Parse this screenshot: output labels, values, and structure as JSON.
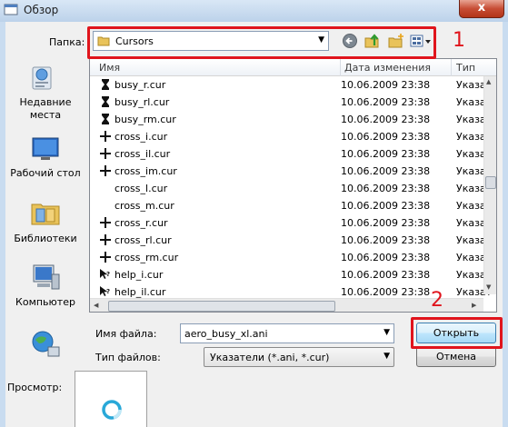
{
  "window": {
    "title": "Обзор",
    "close_glyph": "x"
  },
  "lookin": {
    "label": "Папка:",
    "value": "Cursors",
    "icon": "folder-icon"
  },
  "nav_tools": [
    "back-icon",
    "up-folder-icon",
    "new-folder-icon",
    "view-menu-icon"
  ],
  "places": [
    {
      "label_lines": [
        "Недавние",
        "места"
      ],
      "icon": "recent-places-icon"
    },
    {
      "label_lines": [
        "Рабочий стол"
      ],
      "icon": "desktop-icon"
    },
    {
      "label_lines": [
        "Библиотеки"
      ],
      "icon": "libraries-icon"
    },
    {
      "label_lines": [
        "Компьютер"
      ],
      "icon": "computer-icon"
    },
    {
      "label_lines": [],
      "icon": "network-icon"
    }
  ],
  "list": {
    "columns": [
      "Имя",
      "Дата изменения",
      "Тип"
    ],
    "rows": [
      {
        "name": "busy_r.cur",
        "date": "10.06.2009 23:38",
        "type": "Указат",
        "icon": "hourglass-icon"
      },
      {
        "name": "busy_rl.cur",
        "date": "10.06.2009 23:38",
        "type": "Указат",
        "icon": "hourglass-icon"
      },
      {
        "name": "busy_rm.cur",
        "date": "10.06.2009 23:38",
        "type": "Указат",
        "icon": "hourglass-icon"
      },
      {
        "name": "cross_i.cur",
        "date": "10.06.2009 23:38",
        "type": "Указат",
        "icon": "crosshair-icon"
      },
      {
        "name": "cross_il.cur",
        "date": "10.06.2009 23:38",
        "type": "Указат",
        "icon": "crosshair-icon"
      },
      {
        "name": "cross_im.cur",
        "date": "10.06.2009 23:38",
        "type": "Указат",
        "icon": "crosshair-icon"
      },
      {
        "name": "cross_l.cur",
        "date": "10.06.2009 23:38",
        "type": "Указат",
        "icon": "blank-icon"
      },
      {
        "name": "cross_m.cur",
        "date": "10.06.2009 23:38",
        "type": "Указат",
        "icon": "blank-icon"
      },
      {
        "name": "cross_r.cur",
        "date": "10.06.2009 23:38",
        "type": "Указат",
        "icon": "crosshair-icon"
      },
      {
        "name": "cross_rl.cur",
        "date": "10.06.2009 23:38",
        "type": "Указат",
        "icon": "crosshair-icon"
      },
      {
        "name": "cross_rm.cur",
        "date": "10.06.2009 23:38",
        "type": "Указат",
        "icon": "crosshair-icon"
      },
      {
        "name": "help_i.cur",
        "date": "10.06.2009 23:38",
        "type": "Указат",
        "icon": "help-cursor-icon"
      },
      {
        "name": "help_il.cur",
        "date": "10.06.2009 23:38",
        "type": "Указат",
        "icon": "help-cursor-icon"
      }
    ]
  },
  "filename": {
    "label": "Имя файла:",
    "value": "aero_busy_xl.ani"
  },
  "filetype": {
    "label": "Тип файлов:",
    "value": "Указатели (*.ani, *.cur)"
  },
  "buttons": {
    "open": "Открыть",
    "cancel": "Отмена"
  },
  "preview": {
    "label": "Просмотр:",
    "icon": "busy-ring-icon"
  },
  "callouts": {
    "first": "1",
    "second": "2"
  },
  "colors": {
    "callout_red": "#e0141c",
    "preview_ring": "#29a8d8"
  }
}
